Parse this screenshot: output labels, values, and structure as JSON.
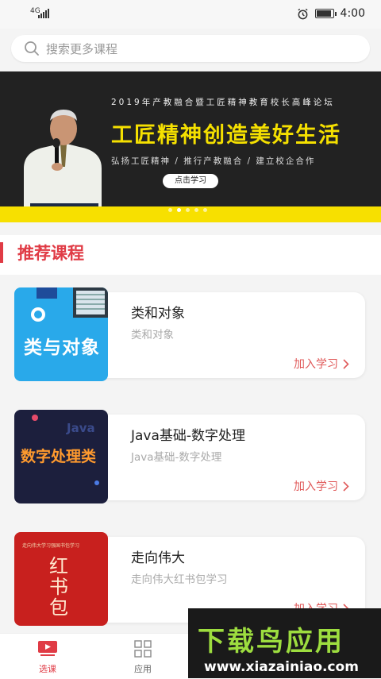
{
  "status": {
    "network": "4G",
    "time": "4:00"
  },
  "search": {
    "placeholder": "搜索更多课程"
  },
  "banner": {
    "forum": "2019年产教融合暨工匠精神教育校长高峰论坛",
    "headline": "工匠精神创造美好生活",
    "sub": "弘扬工匠精神 / 推行产教融合 / 建立校企合作",
    "button": "点击学习",
    "colors": {
      "bg": "#222222",
      "accent": "#f5e000"
    }
  },
  "section": {
    "title": "推荐课程",
    "color": "#e03b45"
  },
  "courses": [
    {
      "title": "类和对象",
      "subtitle": "类和对象",
      "join": "加入学习",
      "thumb_text": "类与对象"
    },
    {
      "title": "Java基础-数字处理",
      "subtitle": "Java基础-数字处理",
      "join": "加入学习",
      "thumb_text": "数字处理类",
      "thumb_tag": "Java"
    },
    {
      "title": "走向伟大",
      "subtitle": "走向伟大红书包学习",
      "join": "加入学习",
      "thumb_text": "红书包",
      "thumb_tag": "走向伟大学习强国书包学习"
    }
  ],
  "tabs": [
    {
      "label": "选课",
      "icon": "play-icon",
      "active": true
    },
    {
      "label": "应用",
      "icon": "grid-icon",
      "active": false
    }
  ],
  "watermark": {
    "main": "下载鸟应用",
    "url": "www.xiazainiao.com"
  }
}
